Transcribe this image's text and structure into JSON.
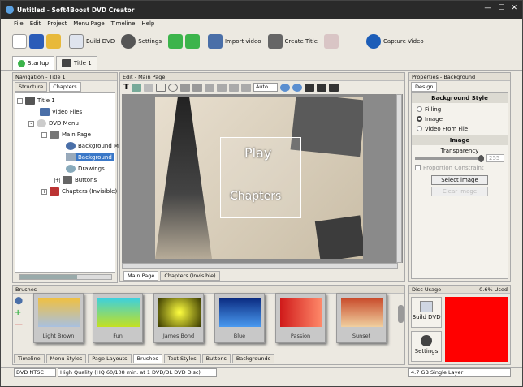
{
  "window": {
    "title": "Untitled - Soft4Boost DVD Creator"
  },
  "menu": [
    "File",
    "Edit",
    "Project",
    "Menu Page",
    "Timeline",
    "Help"
  ],
  "toolbar": {
    "build_dvd": "Build DVD",
    "settings": "Settings",
    "import_video": "Import video",
    "create_title": "Create Title",
    "capture_video": "Capture Video"
  },
  "doc_tabs": [
    "Startup",
    "Title 1"
  ],
  "nav": {
    "header": "Navigation - Title 1",
    "tabs": [
      "Structure",
      "Chapters"
    ],
    "tree": [
      "Title 1",
      "Video Files",
      "DVD Menu",
      "Main Page",
      "Background M",
      "Background",
      "Drawings",
      "Buttons",
      "Chapters (Invisible)"
    ]
  },
  "edit": {
    "header": "Edit - Main Page",
    "zoom": "Auto",
    "page_tabs": [
      "Main Page",
      "Chapters (Invisible)"
    ],
    "menu_play": "Play",
    "menu_chapters": "Chapters"
  },
  "props": {
    "header": "Properties - Background",
    "tab": "Design",
    "bg_style": "Background Style",
    "options": [
      "Filling",
      "Image",
      "Video From File"
    ],
    "image_section": "Image",
    "transparency": "Transparency",
    "transparency_value": "255",
    "proportion": "Proportion Constraint",
    "select_image": "Select image",
    "clear_image": "Clear image"
  },
  "brushes": {
    "header": "Brushes",
    "items": [
      {
        "label": "Light Brown",
        "color": "#d9b24f"
      },
      {
        "label": "Fun",
        "color": "#4bc9c2"
      },
      {
        "label": "James Bond",
        "color": "#c9c21a"
      },
      {
        "label": "Blue",
        "color": "#1b4fb0"
      },
      {
        "label": "Passion",
        "color": "#e83a2a"
      },
      {
        "label": "Sunset",
        "color": "#d26a2a"
      }
    ],
    "tabs": [
      "Timeline",
      "Menu Styles",
      "Page Layouts",
      "Brushes",
      "Text Styles",
      "Buttons",
      "Backgrounds"
    ]
  },
  "disc": {
    "header": "Disc Usage",
    "used": "0.6% Used",
    "build": "Build DVD",
    "settings": "Settings"
  },
  "status": {
    "format": "DVD NTSC",
    "quality": "High Quality (HQ 60/108 min. at 1 DVD/DL DVD Disc)",
    "layer": "4.7 GB Single Layer"
  }
}
